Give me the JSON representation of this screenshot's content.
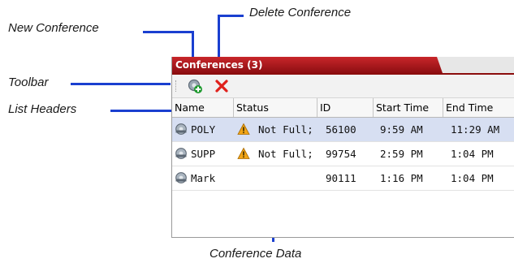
{
  "callouts": {
    "new_conference": "New Conference",
    "delete_conference": "Delete Conference",
    "toolbar": "Toolbar",
    "list_headers": "List Headers",
    "conference_data": "Conference Data"
  },
  "panel": {
    "tab_title": "Conferences (3)",
    "toolbar": {
      "buttons": [
        "add-conference-icon",
        "delete-x-icon"
      ]
    },
    "columns": [
      "Name",
      "Status",
      "ID",
      "Start Time",
      "End Time"
    ],
    "rows": [
      {
        "name": "POLY",
        "status": "Not Full;",
        "id": "56100",
        "start": "9:59 AM",
        "end": "11:29 AM",
        "selected": true
      },
      {
        "name": "SUPP",
        "status": "Not Full;",
        "id": "99754",
        "start": "2:59 PM",
        "end": "1:04 PM",
        "selected": false
      },
      {
        "name": "Mark",
        "status": "",
        "id": "90111",
        "start": "1:16 PM",
        "end": "1:04 PM",
        "selected": false
      }
    ]
  },
  "colors": {
    "callout_line": "#1a3fd0",
    "tab_red": "#b51d21",
    "selection": "#d7dff2",
    "warning": "#f2a516"
  }
}
